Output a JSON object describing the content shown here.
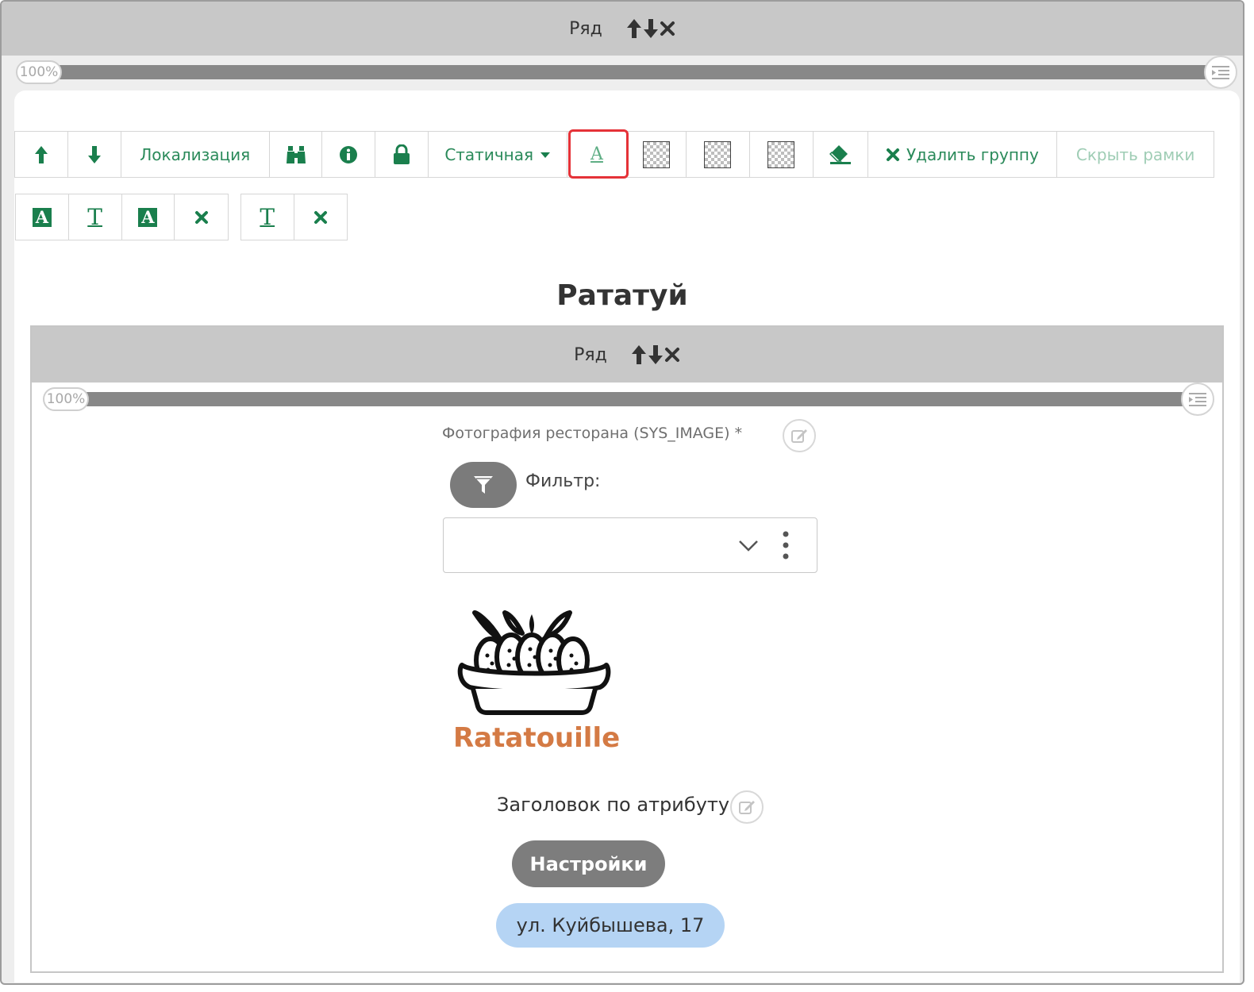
{
  "outer_row": {
    "label": "Ряд",
    "slider_value": "100%"
  },
  "toolbar": {
    "localization_label": "Локализация",
    "mode_label": "Статичная",
    "delete_group_label": "Удалить группу",
    "hide_frames_label": "Скрыть рамки"
  },
  "title": "Рататуй",
  "inner_row": {
    "label": "Ряд",
    "slider_value": "100%"
  },
  "image_field": {
    "label": "Фотография ресторана (SYS_IMAGE) *",
    "filter_label": "Фильтр:",
    "select_value": "",
    "logo_text": "Ratatouille"
  },
  "attribute_heading": "Заголовок по атрибуту",
  "settings_label": "Настройки",
  "address_label": "ул. Куйбышева, 17",
  "colors": {
    "accent": "#1a7f4d",
    "highlight": "#e53238",
    "row_header": "#c8c8c8",
    "logo": "#d47a44",
    "address_pill": "#b5d4f4"
  }
}
